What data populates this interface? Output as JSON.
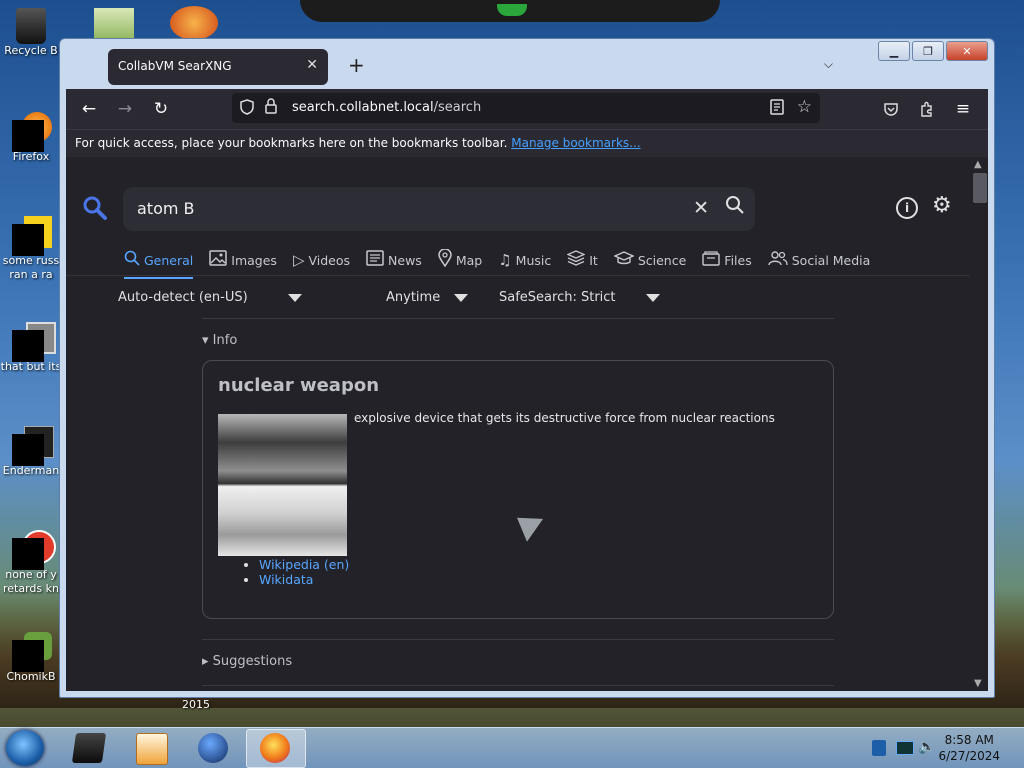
{
  "desktop": {
    "icons": [
      {
        "label": "Recycle B"
      },
      {
        "label": "Firefox"
      },
      {
        "label": "some russ ran a ra"
      },
      {
        "label": "that but its"
      },
      {
        "label": "Enderman"
      },
      {
        "label": "none of y retards kn"
      },
      {
        "label": "ChomikB"
      }
    ],
    "stray_label": "2015"
  },
  "window": {
    "tab_title": "CollabVM SearXNG",
    "tab_close": "✕",
    "new_tab": "+",
    "list_tabs": "⌵",
    "controls": {
      "minimize": "▁",
      "maximize": "❐",
      "close": "✕"
    }
  },
  "navbar": {
    "back": "←",
    "forward": "→",
    "reload": "↻",
    "url_host": "search.collabnet.local",
    "url_path": "/search",
    "icons": {
      "shield": "shield-icon",
      "reader": "reader-view-icon",
      "star": "bookmark-star-icon",
      "pocket": "pocket-icon",
      "extensions": "extensions-icon",
      "menu": "hamburger-menu-icon"
    }
  },
  "bookmarks_bar": {
    "text": "For quick access, place your bookmarks here on the bookmarks toolbar.",
    "link": "Manage bookmarks..."
  },
  "searx": {
    "query": "atom B",
    "categories": [
      {
        "label": "General",
        "icon": "search-icon",
        "active": true
      },
      {
        "label": "Images",
        "icon": "image-icon",
        "active": false
      },
      {
        "label": "Videos",
        "icon": "play-icon",
        "active": false
      },
      {
        "label": "News",
        "icon": "newspaper-icon",
        "active": false
      },
      {
        "label": "Map",
        "icon": "map-pin-icon",
        "active": false
      },
      {
        "label": "Music",
        "icon": "music-icon",
        "active": false
      },
      {
        "label": "It",
        "icon": "layers-icon",
        "active": false
      },
      {
        "label": "Science",
        "icon": "science-icon",
        "active": false
      },
      {
        "label": "Files",
        "icon": "files-icon",
        "active": false
      },
      {
        "label": "Social Media",
        "icon": "people-icon",
        "active": false
      }
    ],
    "filters": {
      "language": "Auto-detect (en-US)",
      "time": "Anytime",
      "safesearch": "SafeSearch: Strict"
    },
    "info_section": "Info",
    "infobox": {
      "title": "nuclear weapon",
      "description": "explosive device that gets its destructive force from nuclear reactions",
      "links": [
        "Wikipedia (en)",
        "Wikidata"
      ]
    },
    "suggestions_section": "Suggestions"
  },
  "taskbar": {
    "time": "8:58 AM",
    "date": "6/27/2024"
  },
  "colors": {
    "accent": "#58a6ff",
    "page_bg": "#222228",
    "toolbar_bg": "#2b2a33"
  }
}
